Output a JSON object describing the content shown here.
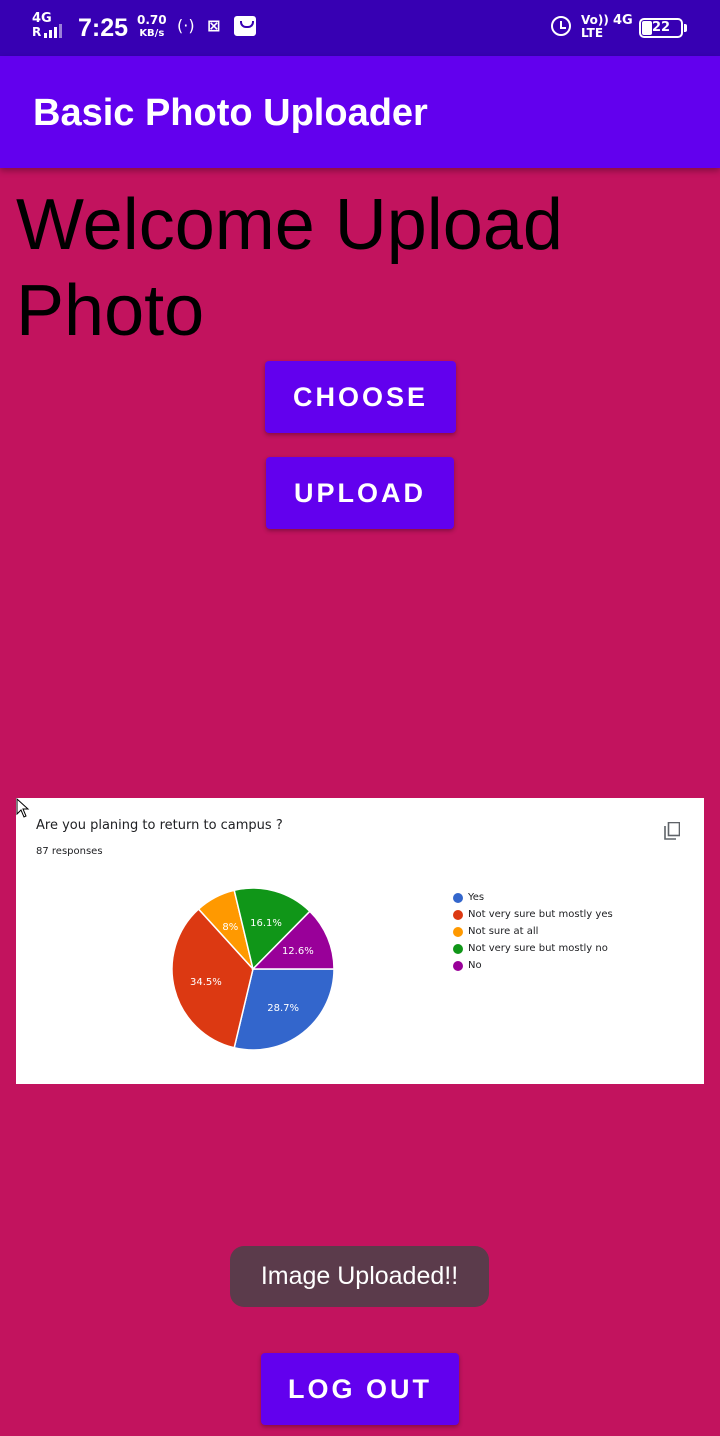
{
  "status_bar": {
    "network": "4G",
    "network_sub": "R",
    "time": "7:25",
    "speed_value": "0.70",
    "speed_unit": "KB/s",
    "volte_top": "Vo))",
    "volte_bottom": "LTE",
    "network_right": "4G",
    "battery": "22",
    "icons": [
      "signal-icon",
      "hotspot-icon",
      "screen-record-icon",
      "shopping-bag-icon",
      "alarm-icon",
      "battery-icon"
    ]
  },
  "app_bar": {
    "title": "Basic Photo Uploader"
  },
  "main": {
    "welcome": "Welcome Upload Photo",
    "choose_label": "CHOOSE",
    "upload_label": "UPLOAD",
    "logout_label": "LOG OUT"
  },
  "preview": {
    "question": "Are you planing to return to campus ?",
    "responses": "87 responses"
  },
  "chart_data": {
    "type": "pie",
    "title": "Are you planing to return to campus ?",
    "subtitle": "87 responses",
    "slices": [
      {
        "label": "Yes",
        "value": 28.7,
        "display": "28.7%",
        "color": "#3366CC"
      },
      {
        "label": "Not very sure but mostly yes",
        "value": 34.5,
        "display": "34.5%",
        "color": "#DC3912"
      },
      {
        "label": "Not sure at all",
        "value": 8.0,
        "display": "8%",
        "color": "#FF9900"
      },
      {
        "label": "Not very sure but mostly no",
        "value": 16.1,
        "display": "16.1%",
        "color": "#109618"
      },
      {
        "label": "No",
        "value": 12.6,
        "display": "12.6%",
        "color": "#990099"
      }
    ],
    "legend_position": "right"
  },
  "toast": {
    "message": "Image Uploaded!!"
  },
  "colors": {
    "background": "#C2135E",
    "primary": "#6200EE",
    "primary_dark": "#3700B3",
    "toast": "#5B3B4B"
  }
}
